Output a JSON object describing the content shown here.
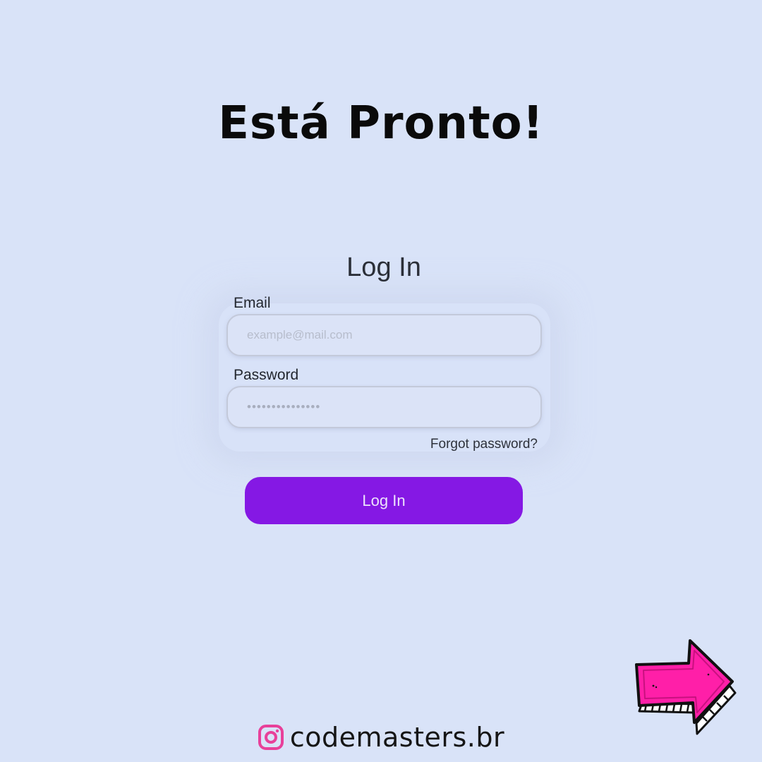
{
  "headline": "Está Pronto!",
  "login": {
    "title": "Log In",
    "email_label": "Email",
    "email_placeholder": "example@mail.com",
    "password_label": "Password",
    "password_placeholder": "•••••••••••••••",
    "forgot_link": "Forgot password?",
    "submit_label": "Log In"
  },
  "footer": {
    "handle": "codemasters.br",
    "icon": "instagram-icon"
  },
  "decoration": {
    "next_arrow_icon": "arrow-right-icon"
  },
  "colors": {
    "background": "#d9e3f8",
    "button": "#8518e4",
    "arrow": "#ff1fa8",
    "instagram_icon": "#e8409a"
  }
}
